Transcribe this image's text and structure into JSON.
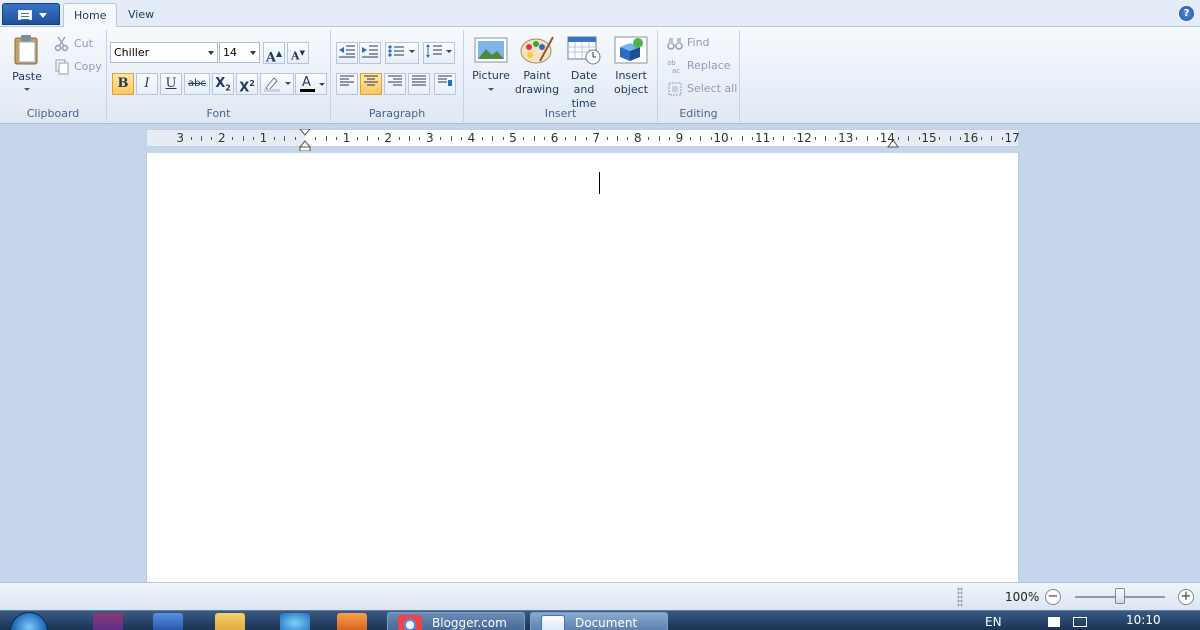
{
  "tabs": [
    {
      "label": "Home",
      "active": true
    },
    {
      "label": "View",
      "active": false
    }
  ],
  "help": {
    "label": "?"
  },
  "clipboard": {
    "paste": "Paste",
    "cut": "Cut",
    "copy": "Copy",
    "group": "Clipboard"
  },
  "font": {
    "family": "Chiller",
    "size": "14",
    "group": "Font",
    "bold": "B",
    "italic": "I",
    "underline": "U",
    "strike": "abc",
    "sub": "X",
    "sub_mark": "2",
    "sup": "X",
    "sup_mark": "2",
    "grow": "A",
    "shrink": "A",
    "color_letter": "A"
  },
  "paragraph": {
    "group": "Paragraph"
  },
  "insert": {
    "picture": "Picture",
    "paint_line1": "Paint",
    "paint_line2": "drawing",
    "date_line1": "Date and",
    "date_line2": "time",
    "object_line1": "Insert",
    "object_line2": "object",
    "group": "Insert"
  },
  "editing": {
    "find": "Find",
    "replace": "Replace",
    "select_all": "Select all",
    "group": "Editing"
  },
  "ruler": {
    "labels": [
      "3",
      "2",
      "1",
      "1",
      "2",
      "3",
      "4",
      "5",
      "6",
      "7",
      "8",
      "9",
      "10",
      "11",
      "12",
      "13",
      "14",
      "15",
      "16",
      "17"
    ]
  },
  "status": {
    "zoom": "100%",
    "zoom_out": "−",
    "zoom_in": "+",
    "zoom_fraction": 0.5
  },
  "taskbar": {
    "task1": "Blogger.com",
    "task2": "Document",
    "lang": "EN",
    "clock": "10:10"
  },
  "colors": {
    "accent": "#2b579a",
    "ribbon_bg": "#dfe8f4",
    "highlight": "#ffc65b",
    "font_color_bar": "#000000"
  }
}
